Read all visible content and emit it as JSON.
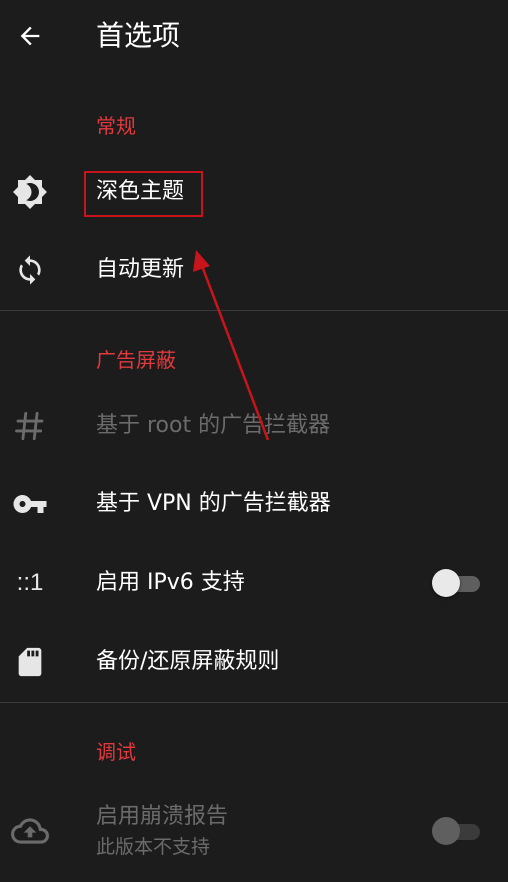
{
  "appbar": {
    "title": "首选项",
    "back_icon": "arrow-left-icon"
  },
  "colors": {
    "background": "#1c1c1c",
    "section_header": "#e0393e",
    "text_primary": "#ffffff",
    "text_disabled": "#6b6b6b",
    "annotation_red": "#c8141b"
  },
  "sections": {
    "general": {
      "header": "常规",
      "items": [
        {
          "icon": "brightness-icon",
          "label": "深色主题"
        },
        {
          "icon": "sync-icon",
          "label": "自动更新"
        }
      ]
    },
    "ad_blocking": {
      "header": "广告屏蔽",
      "items": [
        {
          "icon": "hash-icon",
          "label": "基于 root 的广告拦截器",
          "disabled": true
        },
        {
          "icon": "key-icon",
          "label": "基于 VPN 的广告拦截器"
        },
        {
          "icon": "ipv6-icon",
          "icon_text": "::1",
          "label": "启用 IPv6 支持",
          "switch_on": false
        },
        {
          "icon": "sd-card-icon",
          "label": "备份/还原屏蔽规则"
        }
      ]
    },
    "debug": {
      "header": "调试",
      "items": [
        {
          "icon": "cloud-upload-icon",
          "label": "启用崩溃报告",
          "summary": "此版本不支持",
          "disabled": true,
          "switch_on": false
        }
      ]
    }
  }
}
